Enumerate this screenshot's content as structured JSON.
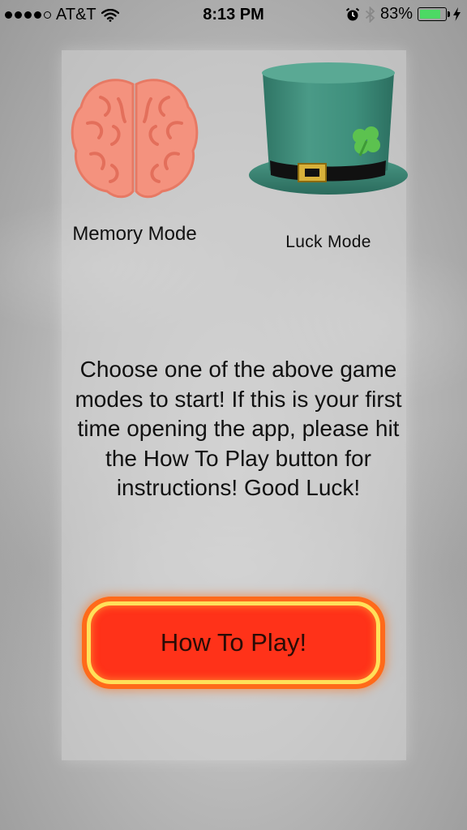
{
  "status_bar": {
    "carrier": "AT&T",
    "time": "8:13 PM",
    "battery_percent": "83%",
    "battery_level": 0.83,
    "icons": [
      "signal-dots-icon",
      "wifi-icon",
      "alarm-icon",
      "bluetooth-icon",
      "battery-icon",
      "charging-bolt-icon"
    ]
  },
  "modes": {
    "memory": {
      "label": "Memory Mode",
      "icon": "brain-icon"
    },
    "luck": {
      "label": "Luck Mode",
      "icon": "leprechaun-hat-icon"
    }
  },
  "instructions": "Choose one of the above game modes to start! If this is your first time opening the app, please hit the How To Play button for instructions! Good Luck!",
  "how_to_play": {
    "label": "How To Play!"
  },
  "colors": {
    "brain": "#f4927e",
    "hat": "#3e8f7c",
    "clover": "#5cc24f",
    "button": "#ff3219",
    "button_border": "#ffe05a",
    "battery_fill": "#4cd964"
  }
}
